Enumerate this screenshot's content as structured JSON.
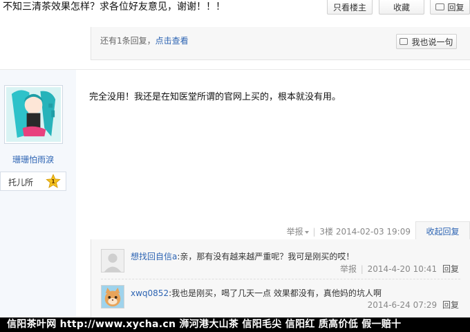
{
  "header": {
    "title": "不知三清茶效果怎样？求各位好友意见，谢谢！！！",
    "only_op_label": "只看楼主",
    "collect_label": "收藏",
    "reply_label": "回复"
  },
  "previous_floor": {
    "more_replies_prefix": "还有1条回复，",
    "more_replies_link": "点击查看",
    "say_label": "我也说一句"
  },
  "post": {
    "author": {
      "name": "珊珊怕雨淚",
      "badge_label": "托儿所",
      "level": "1"
    },
    "content": "完全没用！我还是在知医堂所谓的官网上买的，根本就没有用。",
    "report_label": "举报",
    "floor": "3楼",
    "time": "2014-02-03 19:09",
    "collapse_label": "收起回复"
  },
  "comments": [
    {
      "user": "想找回自信a",
      "text": ":亲，那有没有越来越严重呢？我可是刚买的哎！",
      "report_label": "举报",
      "time": "2014-4-20 10:41",
      "reply_label": "回复"
    },
    {
      "user": "xwq0852",
      "text": ":我也是刚买，喝了几天一点 效果都没有，真他妈的坑人啊",
      "time": "2014-6-24 07:29",
      "reply_label": "回复"
    }
  ],
  "banner": {
    "text": "信阳茶叶网 http://www.xycha.cn 浉河港大山茶 信阳毛尖 信阳红 质高价低 假一赔十"
  },
  "colors": {
    "link": "#2d64b3",
    "banner_bg": "#000000",
    "panel_bg": "#f7f7f7"
  }
}
